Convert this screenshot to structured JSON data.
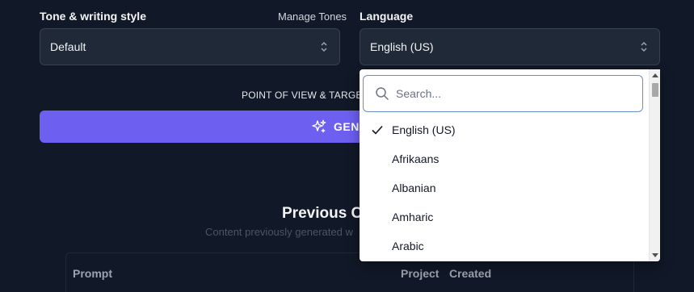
{
  "tone": {
    "label": "Tone & writing style",
    "manage_link": "Manage Tones",
    "value": "Default"
  },
  "language": {
    "label": "Language",
    "value": "English (US)"
  },
  "pov_label": "POINT OF VIEW & TARGET",
  "generate_label": "GENE",
  "previous": {
    "title": "Previous C",
    "subtitle": "Content previously generated w"
  },
  "table": {
    "headers": [
      "Prompt",
      "Project",
      "Created"
    ]
  },
  "dropdown": {
    "search_placeholder": "Search...",
    "options": [
      {
        "label": "English (US)",
        "selected": true
      },
      {
        "label": "Afrikaans",
        "selected": false
      },
      {
        "label": "Albanian",
        "selected": false
      },
      {
        "label": "Amharic",
        "selected": false
      },
      {
        "label": "Arabic",
        "selected": false
      }
    ]
  },
  "colors": {
    "background": "#111827",
    "field": "#1f2937",
    "accent": "#6d5ff0"
  }
}
